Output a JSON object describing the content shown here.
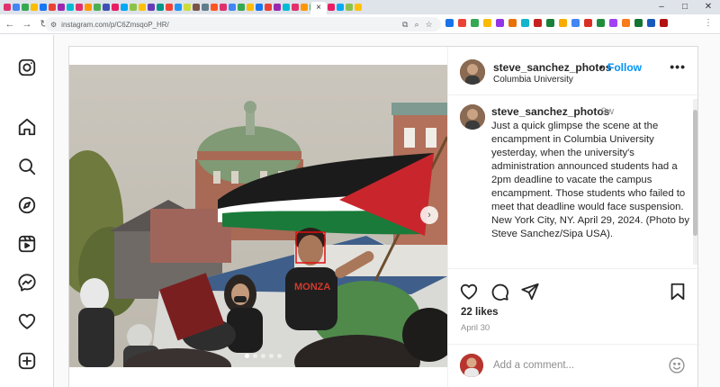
{
  "browser": {
    "url": "instagram.com/p/C6ZmsqoP_HR/",
    "active_tab_close": "×",
    "new_tab": "+",
    "window_controls": [
      "–",
      "□",
      "✕"
    ],
    "tab_favicon_colors": [
      "#e1306c",
      "#4285f4",
      "#34a853",
      "#fbbc05",
      "#1877f2",
      "#ea4335",
      "#9c27b0",
      "#00bcd4",
      "#e1306c",
      "#ff9800",
      "#4caf50",
      "#3f51b5",
      "#e91e63",
      "#03a9f4",
      "#8bc34a",
      "#ffc107",
      "#673ab7",
      "#009688",
      "#f44336",
      "#2196f3",
      "#cddc39",
      "#795548",
      "#607d8b",
      "#ff5722",
      "#e1306c",
      "#4285f4",
      "#34a853",
      "#fbbc05",
      "#1877f2",
      "#ea4335",
      "#9c27b0",
      "#00bcd4",
      "#e1306c",
      "#ff9800",
      "#4caf50",
      "#3f51b5",
      "#e91e63",
      "#03a9f4",
      "#8bc34a",
      "#ffc107"
    ],
    "extension_colors": [
      "#1a73e8",
      "#ea4335",
      "#34a853",
      "#fbbc05",
      "#9334e6",
      "#e8710a",
      "#12b5cb",
      "#c5221f",
      "#188038",
      "#f9ab00",
      "#4285f4",
      "#d93025",
      "#1e8e3e",
      "#a142f4",
      "#fa7b17",
      "#137333",
      "#185abc",
      "#b31412"
    ]
  },
  "nav": {
    "icons": [
      "instagram-logo",
      "home",
      "search",
      "explore",
      "reels",
      "messages",
      "notifications",
      "create"
    ]
  },
  "post": {
    "author": {
      "username": "steve_sanchez_photos",
      "separator": "•",
      "follow_label": "Follow",
      "location": "Columbia University",
      "more": "•••"
    },
    "caption": {
      "username": "steve_sanchez_photos",
      "time_ago": "9w",
      "text": "Just a quick glimpse the scene at the encampment in Columbia University yesterday, when the university's administration announced students had a 2pm deadline to vacate the campus encampment. Those students who failed to meet that deadline would face suspension. New York City, NY. April 29, 2024. (Photo by Steve Sanchez/Sipa USA)."
    },
    "carousel": {
      "next_label": "›",
      "slide_count": 5,
      "current_slide": 1
    },
    "likes": "22 likes",
    "date": "April 30",
    "comment_placeholder": "Add a comment...",
    "photo_text": "MONZA",
    "colors": {
      "accent": "#0095f6",
      "flag_red": "#c8262c",
      "flag_green": "#1a7a3a",
      "flag_black": "#1b1b1b",
      "face_box": "#e01010"
    }
  }
}
